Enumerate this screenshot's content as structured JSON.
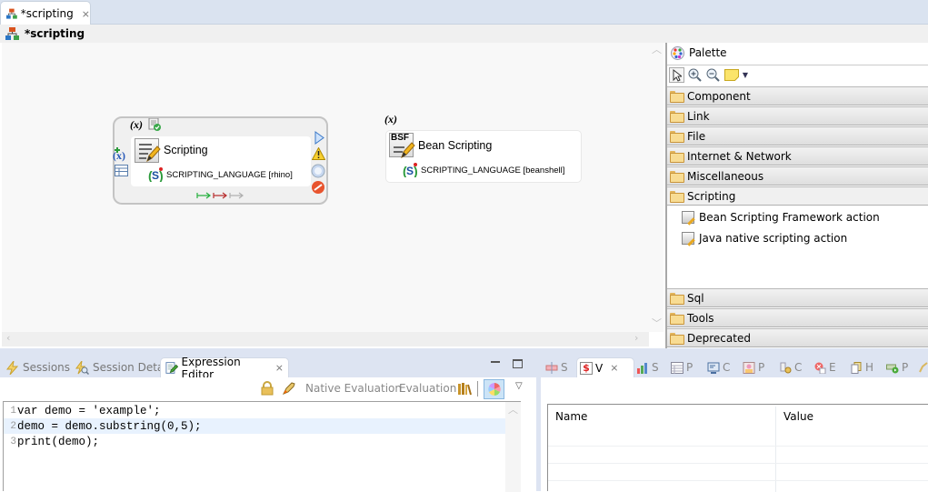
{
  "editor_tab": {
    "label": "*scripting",
    "close": "⨯"
  },
  "title_bar": {
    "title": "*scripting"
  },
  "diagram": {
    "nodes": [
      {
        "title": "Scripting",
        "variable_marker": "(x)",
        "property": "SCRIPTING_LANGUAGE [rhino]",
        "status_icons": [
          "play-icon",
          "warning-icon",
          "circle-icon",
          "forbidden-icon"
        ]
      },
      {
        "title": "Bean Scripting",
        "icon_label": "BSF",
        "variable_marker": "(x)",
        "property": "SCRIPTING_LANGUAGE [beanshell]"
      }
    ]
  },
  "palette": {
    "title": "Palette",
    "drawers": [
      {
        "label": "Component",
        "open": false
      },
      {
        "label": "Link",
        "open": false
      },
      {
        "label": "File",
        "open": false
      },
      {
        "label": "Internet & Network",
        "open": false
      },
      {
        "label": "Miscellaneous",
        "open": false
      },
      {
        "label": "Scripting",
        "open": true,
        "entries": [
          "Bean Scripting Framework action",
          "Java native scripting action"
        ]
      },
      {
        "label": "Sql",
        "open": false
      },
      {
        "label": "Tools",
        "open": false
      },
      {
        "label": "Deprecated",
        "open": false
      }
    ]
  },
  "bottom_left": {
    "tabs": [
      {
        "label": "Sessions",
        "active": false
      },
      {
        "label": "Session Detail",
        "active": false
      },
      {
        "label": "Expression Editor",
        "active": true,
        "close": "⨯"
      }
    ],
    "toolbar": {
      "native_evaluation": "Native Evaluation",
      "evaluation": "Evaluation"
    },
    "code": [
      {
        "n": "1",
        "text": "var demo = 'example';"
      },
      {
        "n": "2",
        "text": "demo = demo.substring(0,5);",
        "current": true
      },
      {
        "n": "3",
        "text": "print(demo);"
      }
    ]
  },
  "bottom_right": {
    "tabs": [
      {
        "label": "S"
      },
      {
        "label": "V",
        "active": true,
        "close": "⨯"
      },
      {
        "label": "S"
      },
      {
        "label": "P"
      },
      {
        "label": "C"
      },
      {
        "label": "P"
      },
      {
        "label": "C"
      },
      {
        "label": "E"
      },
      {
        "label": "H"
      },
      {
        "label": "P"
      }
    ],
    "table": {
      "columns": [
        "Name",
        "Value"
      ],
      "rows": []
    }
  }
}
